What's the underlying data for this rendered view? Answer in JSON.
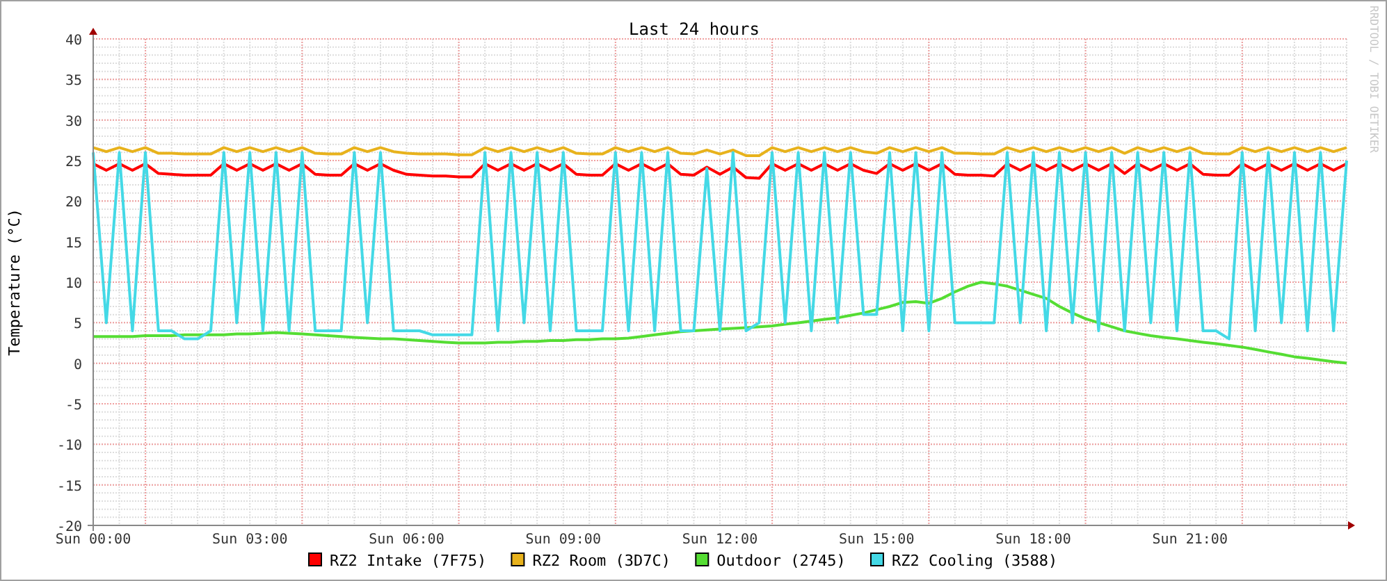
{
  "chart": {
    "credit": "RRDTOOL / TOBI OETIKER",
    "chart_data": {
      "type": "line",
      "title": "Last 24 hours",
      "ylabel": "Temperature (°C)",
      "categories": [
        "Sun 00:00",
        null,
        null,
        null,
        null,
        null,
        null,
        null,
        null,
        null,
        null,
        null,
        "Sun 03:00",
        null,
        null,
        null,
        null,
        null,
        null,
        null,
        null,
        null,
        null,
        null,
        "Sun 06:00",
        null,
        null,
        null,
        null,
        null,
        null,
        null,
        null,
        null,
        null,
        null,
        "Sun 09:00",
        null,
        null,
        null,
        null,
        null,
        null,
        null,
        null,
        null,
        null,
        null,
        "Sun 12:00",
        null,
        null,
        null,
        null,
        null,
        null,
        null,
        null,
        null,
        null,
        null,
        "Sun 15:00",
        null,
        null,
        null,
        null,
        null,
        null,
        null,
        null,
        null,
        null,
        null,
        "Sun 18:00",
        null,
        null,
        null,
        null,
        null,
        null,
        null,
        null,
        null,
        null,
        null,
        "Sun 21:00",
        null,
        null,
        null,
        null,
        null,
        null,
        null,
        null,
        null,
        null,
        null,
        null
      ],
      "ylim": [
        -20,
        40
      ],
      "grid": true,
      "legend": "bottom",
      "yticks": [
        -20,
        -15,
        -10,
        -5,
        0,
        5,
        10,
        15,
        20,
        25,
        30,
        35,
        40
      ],
      "series": [
        {
          "name": "RZ2 Intake (7F75)",
          "color": "#ff0000",
          "values": [
            24.6,
            23.8,
            24.6,
            23.8,
            24.6,
            23.4,
            23.3,
            23.2,
            23.2,
            23.2,
            24.6,
            23.8,
            24.6,
            23.8,
            24.6,
            23.8,
            24.6,
            23.3,
            23.2,
            23.2,
            24.6,
            23.8,
            24.6,
            23.8,
            23.3,
            23.2,
            23.1,
            23.1,
            23.0,
            23.0,
            24.6,
            23.8,
            24.6,
            23.8,
            24.6,
            23.8,
            24.6,
            23.3,
            23.2,
            23.2,
            24.6,
            23.8,
            24.6,
            23.8,
            24.6,
            23.3,
            23.2,
            24.2,
            23.3,
            24.2,
            22.9,
            22.8,
            24.6,
            23.8,
            24.6,
            23.8,
            24.6,
            23.8,
            24.6,
            23.8,
            23.4,
            24.6,
            23.8,
            24.6,
            23.8,
            24.6,
            23.3,
            23.2,
            23.2,
            23.1,
            24.6,
            23.8,
            24.6,
            23.8,
            24.6,
            23.8,
            24.6,
            23.8,
            24.6,
            23.4,
            24.6,
            23.8,
            24.6,
            23.8,
            24.6,
            23.3,
            23.2,
            23.2,
            24.6,
            23.8,
            24.6,
            23.8,
            24.6,
            23.8,
            24.6,
            23.8,
            24.6
          ]
        },
        {
          "name": "RZ2 Room (3D7C)",
          "color": "#e8b21c",
          "values": [
            26.6,
            26.1,
            26.6,
            26.1,
            26.6,
            25.9,
            25.9,
            25.8,
            25.8,
            25.8,
            26.6,
            26.1,
            26.6,
            26.1,
            26.6,
            26.1,
            26.6,
            25.9,
            25.8,
            25.8,
            26.6,
            26.1,
            26.6,
            26.1,
            25.9,
            25.8,
            25.8,
            25.8,
            25.7,
            25.7,
            26.6,
            26.1,
            26.6,
            26.1,
            26.6,
            26.1,
            26.6,
            25.9,
            25.8,
            25.8,
            26.6,
            26.1,
            26.6,
            26.1,
            26.6,
            25.9,
            25.8,
            26.3,
            25.8,
            26.3,
            25.6,
            25.6,
            26.6,
            26.1,
            26.6,
            26.1,
            26.6,
            26.1,
            26.6,
            26.1,
            25.9,
            26.6,
            26.1,
            26.6,
            26.1,
            26.6,
            25.9,
            25.9,
            25.8,
            25.8,
            26.6,
            26.1,
            26.6,
            26.1,
            26.6,
            26.1,
            26.6,
            26.1,
            26.6,
            25.9,
            26.6,
            26.1,
            26.6,
            26.1,
            26.6,
            25.9,
            25.8,
            25.8,
            26.6,
            26.1,
            26.6,
            26.1,
            26.6,
            26.1,
            26.6,
            26.1,
            26.6
          ]
        },
        {
          "name": "Outdoor (2745)",
          "color": "#55dd33",
          "values": [
            3.3,
            3.3,
            3.3,
            3.3,
            3.4,
            3.4,
            3.4,
            3.5,
            3.5,
            3.5,
            3.5,
            3.6,
            3.6,
            3.7,
            3.8,
            3.7,
            3.6,
            3.5,
            3.4,
            3.3,
            3.2,
            3.1,
            3.0,
            3.0,
            2.9,
            2.8,
            2.7,
            2.6,
            2.5,
            2.5,
            2.5,
            2.6,
            2.6,
            2.7,
            2.7,
            2.8,
            2.8,
            2.9,
            2.9,
            3.0,
            3.0,
            3.1,
            3.3,
            3.5,
            3.7,
            3.9,
            4.0,
            4.1,
            4.2,
            4.3,
            4.4,
            4.5,
            4.6,
            4.8,
            5.0,
            5.2,
            5.4,
            5.6,
            5.9,
            6.2,
            6.6,
            7.0,
            7.5,
            7.6,
            7.4,
            8.0,
            8.8,
            9.5,
            10.0,
            9.8,
            9.5,
            9.0,
            8.5,
            8.0,
            7.0,
            6.2,
            5.5,
            5.0,
            4.5,
            4.0,
            3.7,
            3.4,
            3.2,
            3.0,
            2.8,
            2.6,
            2.4,
            2.2,
            2.0,
            1.7,
            1.4,
            1.1,
            0.8,
            0.6,
            0.4,
            0.2,
            0.0
          ]
        },
        {
          "name": "RZ2 Cooling (3588)",
          "color": "#44d9e6",
          "values": [
            26,
            5,
            26,
            4,
            26,
            4,
            4,
            3,
            3,
            4,
            26,
            5,
            26,
            4,
            26,
            4,
            26,
            4,
            4,
            4,
            26,
            5,
            26,
            4,
            4,
            4,
            3.5,
            3.5,
            3.5,
            3.5,
            26,
            4,
            26,
            5,
            26,
            4,
            26,
            4,
            4,
            4,
            26,
            4,
            26,
            4,
            26,
            4,
            4,
            24,
            4,
            26,
            4,
            5,
            26,
            5,
            26,
            4,
            26,
            5,
            26,
            6,
            6,
            26,
            4,
            26,
            4,
            26,
            5,
            5,
            5,
            5,
            26,
            5,
            26,
            4,
            26,
            5,
            26,
            4,
            26,
            4,
            26,
            5,
            26,
            4,
            26,
            4,
            4,
            3,
            26,
            4,
            26,
            5,
            26,
            4,
            26,
            4,
            25
          ]
        }
      ]
    }
  }
}
